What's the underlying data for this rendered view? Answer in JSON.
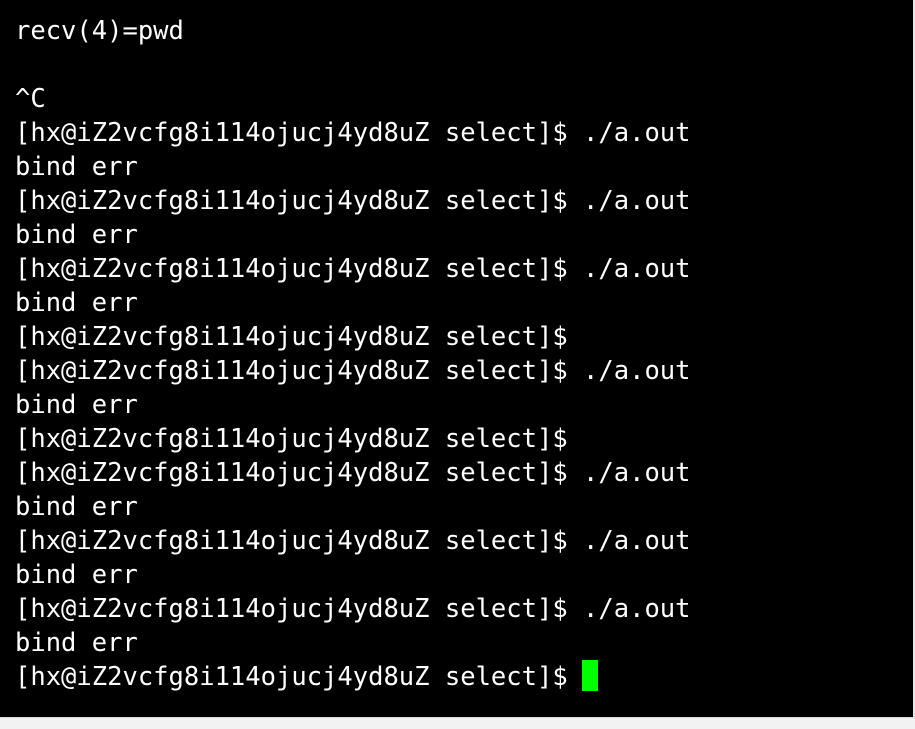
{
  "terminal": {
    "background": "#000000",
    "foreground": "#ffffff",
    "cursor_color": "#00ff00",
    "lines": [
      "recv(4)=pwd",
      "",
      "^C",
      "[hx@iZ2vcfg8i114ojucj4yd8uZ select]$ ./a.out",
      "bind err",
      "[hx@iZ2vcfg8i114ojucj4yd8uZ select]$ ./a.out",
      "bind err",
      "[hx@iZ2vcfg8i114ojucj4yd8uZ select]$ ./a.out",
      "bind err",
      "[hx@iZ2vcfg8i114ojucj4yd8uZ select]$",
      "[hx@iZ2vcfg8i114ojucj4yd8uZ select]$ ./a.out",
      "bind err",
      "[hx@iZ2vcfg8i114ojucj4yd8uZ select]$",
      "[hx@iZ2vcfg8i114ojucj4yd8uZ select]$ ./a.out",
      "bind err",
      "[hx@iZ2vcfg8i114ojucj4yd8uZ select]$ ./a.out",
      "bind err",
      "[hx@iZ2vcfg8i114ojucj4yd8uZ select]$ ./a.out",
      "bind err"
    ],
    "prompt_line": "[hx@iZ2vcfg8i114ojucj4yd8uZ select]$"
  }
}
